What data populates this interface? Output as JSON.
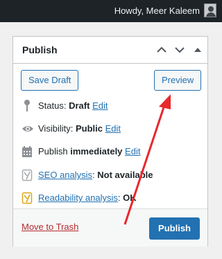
{
  "admin_bar": {
    "greeting": "Howdy, Meer Kaleem"
  },
  "panel": {
    "title": "Publish",
    "save_draft_label": "Save Draft",
    "preview_label": "Preview",
    "status": {
      "label": "Status:",
      "value": "Draft",
      "edit": "Edit"
    },
    "visibility": {
      "label": "Visibility:",
      "value": "Public",
      "edit": "Edit"
    },
    "schedule": {
      "label": "Publish",
      "value": "immediately",
      "edit": "Edit"
    },
    "seo": {
      "link": "SEO analysis",
      "value": "Not available"
    },
    "readability": {
      "link": "Readability analysis",
      "value": "OK"
    },
    "move_to_trash_label": "Move to Trash",
    "publish_label": "Publish"
  },
  "colors": {
    "accent": "#2271b1",
    "annotation_arrow": "#e8282b",
    "trash": "#b32d2e",
    "seo_icon": "#a7aaad",
    "readability_icon": "#dba617"
  }
}
